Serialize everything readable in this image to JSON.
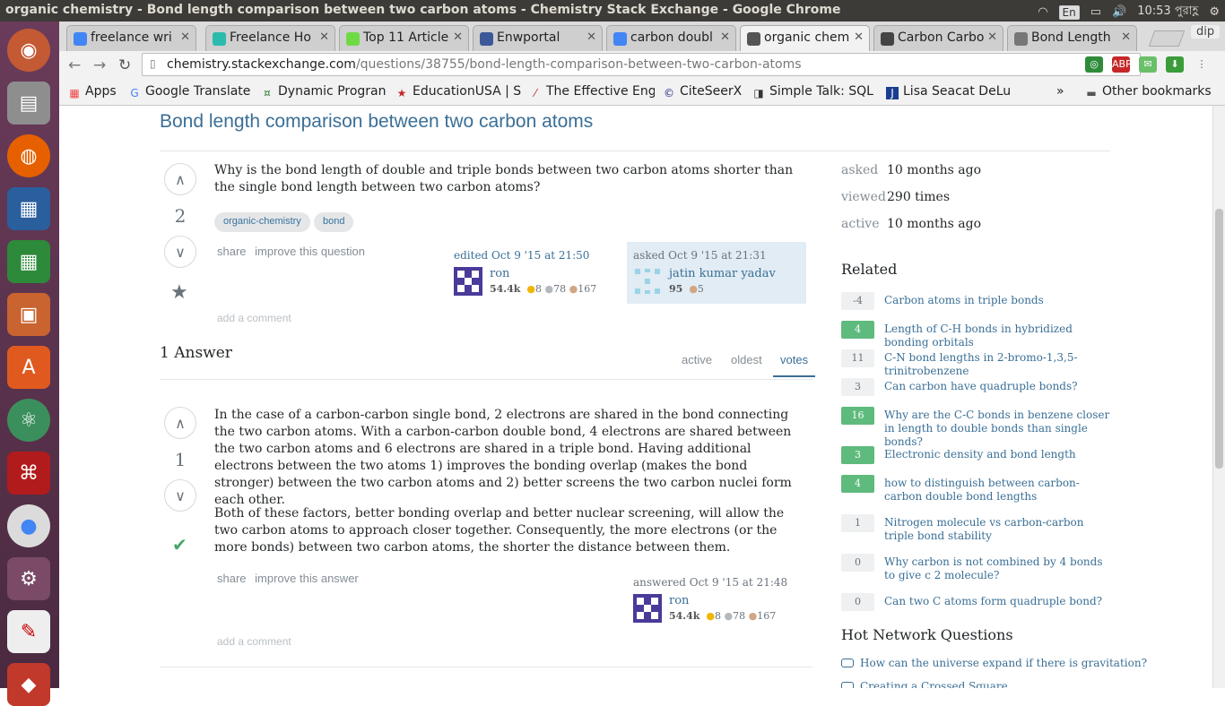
{
  "os": {
    "window_title": "organic chemistry - Bond length comparison between two carbon atoms - Chemistry Stack Exchange - Google Chrome",
    "keyboard": "En",
    "time": "10:53",
    "date_locale": "পুরাহ্ণ"
  },
  "browser": {
    "tabs": [
      {
        "label": "freelance wri",
        "icon": "google-icon",
        "color": "#4285f4"
      },
      {
        "label": "Freelance Ho",
        "icon": "feather-icon",
        "color": "#2bbbad"
      },
      {
        "label": "Top 11 Article",
        "icon": "upwork-icon",
        "color": "#6fda44"
      },
      {
        "label": "Enwportal",
        "icon": "facebook-icon",
        "color": "#3b5998"
      },
      {
        "label": "carbon doubl",
        "icon": "google-icon",
        "color": "#4285f4"
      },
      {
        "label": "organic chem",
        "icon": "molecule-icon",
        "color": "#555555"
      },
      {
        "label": "Carbon Carbo",
        "icon": "page-icon",
        "color": "#444444"
      },
      {
        "label": "Bond Length",
        "icon": "doc-icon",
        "color": "#777777"
      }
    ],
    "profile": "dip",
    "url_host": "chemistry.stackexchange.com",
    "url_path": "/questions/38755/bond-length-comparison-between-two-carbon-atoms",
    "bookmarks": [
      "Apps",
      "Google Translate",
      "Dynamic Progran",
      "EducationUSA | S",
      "The Effective Eng",
      "CiteSeerX",
      "Simple Talk: SQL",
      "Lisa Seacat DeLu"
    ],
    "other_bookmarks": "Other bookmarks"
  },
  "question": {
    "title": "Bond length comparison between two carbon atoms",
    "votes": "2",
    "body": "Why is the bond length of double and triple bonds between two carbon atoms shorter than the single bond length between two carbon atoms?",
    "tags": [
      "organic-chemistry",
      "bond"
    ],
    "share": "share",
    "improve": "improve this question",
    "edited": "edited Oct 9 '15 at 21:50",
    "editor": {
      "name": "ron",
      "rep": "54.4k",
      "gold": "8",
      "silver": "78",
      "bronze": "167"
    },
    "asked": "asked Oct 9 '15 at 21:31",
    "author": {
      "name": "jatin kumar yadav",
      "rep": "95",
      "bronze": "5"
    },
    "add_comment": "add a comment"
  },
  "answers_header": "1 Answer",
  "sort_tabs": [
    "active",
    "oldest",
    "votes"
  ],
  "answer": {
    "votes": "1",
    "para1": "In the case of a carbon-carbon single bond, 2 electrons are shared in the bond connecting the two carbon atoms. With a carbon-carbon double bond, 4 electrons are shared between the two carbon atoms and 6 electrons are shared in a triple bond. Having additional electrons between the two atoms 1) improves the bonding overlap (makes the bond stronger) between the two carbon atoms and 2) better screens the two carbon nuclei form each other.",
    "para2": "Both of these factors, better bonding overlap and better nuclear screening, will allow the two carbon atoms to approach closer together. Consequently, the more electrons (or the more bonds) between two carbon atoms, the shorter the distance between them.",
    "share": "share",
    "improve": "improve this answer",
    "answered": "answered Oct 9 '15 at 21:48",
    "author": {
      "name": "ron",
      "rep": "54.4k",
      "gold": "8",
      "silver": "78",
      "bronze": "167"
    },
    "add_comment": "add a comment"
  },
  "stats": [
    {
      "k": "asked",
      "v": "10 months ago"
    },
    {
      "k": "viewed",
      "v": "290 times"
    },
    {
      "k": "active",
      "v": "10 months ago"
    }
  ],
  "related_title": "Related",
  "related": [
    {
      "n": "-4",
      "t": "Carbon atoms in triple bonds",
      "pos": false
    },
    {
      "n": "4",
      "t": "Length of C-H bonds in hybridized bonding orbitals",
      "pos": true
    },
    {
      "n": "11",
      "t": "C-N bond lengths in 2-bromo-1,3,5-trinitrobenzene",
      "pos": false
    },
    {
      "n": "3",
      "t": "Can carbon have quadruple bonds?",
      "pos": false
    },
    {
      "n": "16",
      "t": "Why are the C-C bonds in benzene closer in length to double bonds than single bonds?",
      "pos": true
    },
    {
      "n": "3",
      "t": "Electronic density and bond length",
      "pos": true
    },
    {
      "n": "4",
      "t": "how to distinguish between carbon-carbon double bond lengths",
      "pos": true
    },
    {
      "n": "1",
      "t": "Nitrogen molecule vs carbon-carbon triple bond stability",
      "pos": false
    },
    {
      "n": "0",
      "t": "Why carbon is not combined by 4 bonds to give c 2 molecule?",
      "pos": false
    },
    {
      "n": "0",
      "t": "Can two C atoms form quadruple bond?",
      "pos": false
    }
  ],
  "hot_title": "Hot Network Questions",
  "hot": [
    "How can the universe expand if there is gravitation?",
    "Creating a Crossed Square"
  ]
}
